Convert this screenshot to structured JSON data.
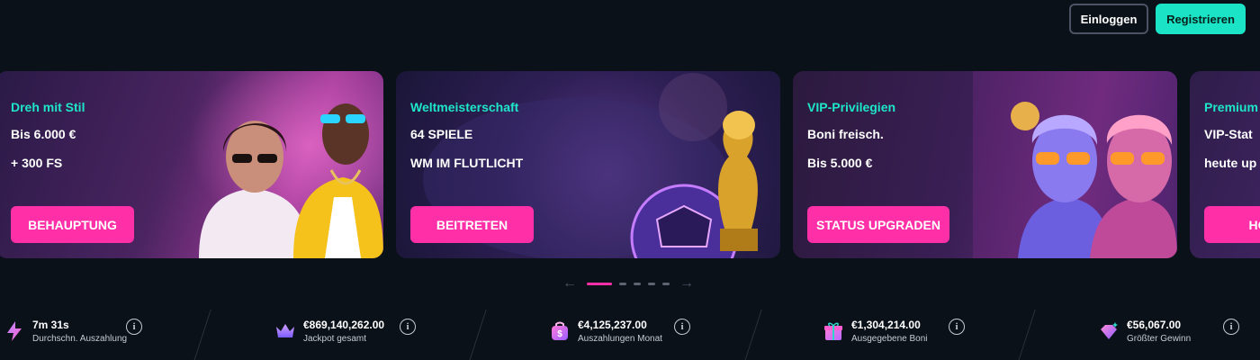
{
  "header": {
    "login_label": "Einloggen",
    "register_label": "Registrieren"
  },
  "carousel": {
    "cards": [
      {
        "kicker": "Dreh mit Stil",
        "line1": "Bis 6.000 €",
        "line2": "+ 300 FS",
        "cta": "BEHAUPTUNG"
      },
      {
        "kicker": "Weltmeisterschaft",
        "line1": "64 SPIELE",
        "line2": "WM IM FLUTLICHT",
        "cta": "BEITRETEN"
      },
      {
        "kicker": "VIP-Privilegien",
        "line1": "Boni freisch.",
        "line2": "Bis 5.000 €",
        "cta": "STATUS UPGRADEN"
      },
      {
        "kicker": "Premium",
        "line1": "VIP-Stat",
        "line2": "heute up",
        "cta": "HO"
      }
    ],
    "pager": {
      "prev_icon": "arrow-left-icon",
      "next_icon": "arrow-right-icon",
      "slide_count": 5,
      "active_index": 0
    }
  },
  "stats": [
    {
      "icon": "lightning-icon",
      "value": "7m 31s",
      "label": "Durchschn. Auszahlung"
    },
    {
      "icon": "crown-icon",
      "value": "€869,140,262.00",
      "label": "Jackpot gesamt"
    },
    {
      "icon": "money-bag-icon",
      "value": "€4,125,237.00",
      "label": "Auszahlungen Monat"
    },
    {
      "icon": "gift-icon",
      "value": "€1,304,214.00",
      "label": "Ausgegebene Boni"
    },
    {
      "icon": "diamond-icon",
      "value": "€56,067.00",
      "label": "Größter Gewinn"
    }
  ],
  "colors": {
    "background": "#0b1119",
    "accent_teal": "#1be3c5",
    "accent_pink": "#ff2fa8"
  }
}
